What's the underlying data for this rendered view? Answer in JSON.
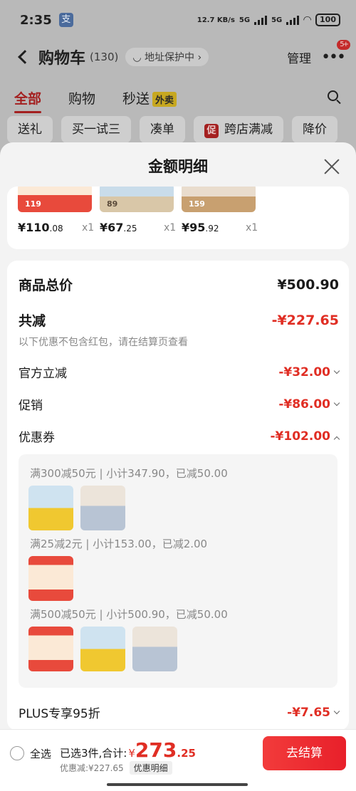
{
  "status_bar": {
    "time": "2:35",
    "app_badge": "支",
    "net_speed": "12.7 KB/s",
    "net_type_1": "5G",
    "net_type_2": "5G",
    "battery": "100"
  },
  "nav": {
    "title": "购物车",
    "count": "(130)",
    "address": "地址保护中",
    "manage": "管理",
    "badge": "5+"
  },
  "tabs": [
    {
      "label": "全部"
    },
    {
      "label": "购物"
    },
    {
      "label": "秒送",
      "tag": "外卖"
    }
  ],
  "chips": [
    {
      "label": "送礼"
    },
    {
      "label": "买一试三"
    },
    {
      "label": "凑单"
    },
    {
      "label": "跨店满减",
      "tag": "促"
    },
    {
      "label": "降价"
    }
  ],
  "sheet": {
    "title": "金额明细",
    "products": [
      {
        "price_int": "¥110",
        "price_dec": ".08",
        "qty": "x1",
        "img_text": "119",
        "color": "#e84a3c"
      },
      {
        "price_int": "¥67",
        "price_dec": ".25",
        "qty": "x1",
        "img_text": "89",
        "color": "#5a8dc0"
      },
      {
        "price_int": "¥95",
        "price_dec": ".92",
        "qty": "x1",
        "img_text": "159",
        "color": "#c8a070"
      }
    ],
    "total_label": "商品总价",
    "total_value": "¥500.90",
    "reduce_label": "共减",
    "reduce_value": "-¥227.65",
    "reduce_note": "以下优惠不包含红包，请在结算页查看",
    "official_label": "官方立减",
    "official_value": "-¥32.00",
    "promo_label": "促销",
    "promo_value": "-¥86.00",
    "coupon_label": "优惠券",
    "coupon_value": "-¥102.00",
    "coupon_groups": [
      {
        "title": "满300减50元 | 小计347.90，已减50.00",
        "thumbs": [
          "#f0c830",
          "#b8c4d4"
        ]
      },
      {
        "title": "满25减2元 | 小计153.00，已减2.00",
        "thumbs": [
          "#e84a3c"
        ]
      },
      {
        "title": "满500减50元 | 小计500.90，已减50.00",
        "thumbs": [
          "#e84a3c",
          "#f0c830",
          "#b8c4d4"
        ]
      }
    ],
    "plus_label": "PLUS专享95折",
    "plus_value": "-¥7.65"
  },
  "bottom": {
    "select_all": "全选",
    "summary_prefix": "已选3件,合计:",
    "yen": "¥",
    "total_int": "273",
    "total_dec": ".25",
    "discount_text": "优惠减:¥227.65",
    "discount_button": "优惠明细",
    "checkout": "去结算"
  }
}
